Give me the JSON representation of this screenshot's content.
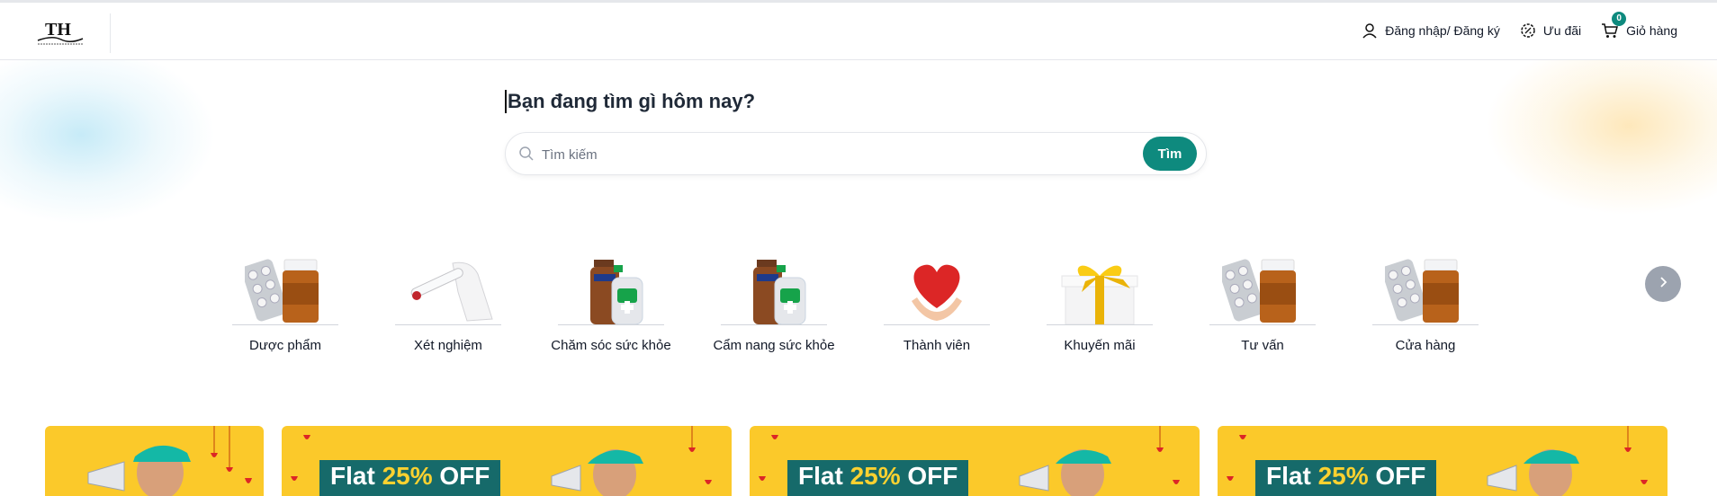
{
  "brand": {
    "logo_text": "TH"
  },
  "header": {
    "login": "Đăng nhập/ Đăng ký",
    "deals": "Ưu đãi",
    "cart": "Giỏ hàng",
    "cart_count": "0"
  },
  "hero": {
    "title": "Bạn đang tìm gì hôm nay?",
    "search_placeholder": "Tìm kiếm",
    "search_button": "Tìm"
  },
  "categories": [
    {
      "label": "Dược phẩm",
      "icon": "pills-bottle-icon"
    },
    {
      "label": "Xét nghiệm",
      "icon": "test-tube-icon"
    },
    {
      "label": "Chăm sóc sức khỏe",
      "icon": "lotion-bottles-icon"
    },
    {
      "label": "Cẩm nang sức khỏe",
      "icon": "lotion-bottles-icon"
    },
    {
      "label": "Thành viên",
      "icon": "heart-hands-icon"
    },
    {
      "label": "Khuyến mãi",
      "icon": "gift-box-icon"
    },
    {
      "label": "Tư vấn",
      "icon": "pills-bottle-icon"
    },
    {
      "label": "Cửa hàng",
      "icon": "pills-bottle-icon"
    }
  ],
  "banners": [
    {
      "prefix": "",
      "highlight": "",
      "suffix": ""
    },
    {
      "prefix": "Flat ",
      "highlight": "25%",
      "suffix": " OFF"
    },
    {
      "prefix": "Flat ",
      "highlight": "25%",
      "suffix": " OFF"
    },
    {
      "prefix": "Flat ",
      "highlight": "25%",
      "suffix": " OFF"
    }
  ],
  "colors": {
    "accent": "#0e8a7e",
    "banner": "#fbc92a",
    "banner_tag": "#166a6a"
  }
}
